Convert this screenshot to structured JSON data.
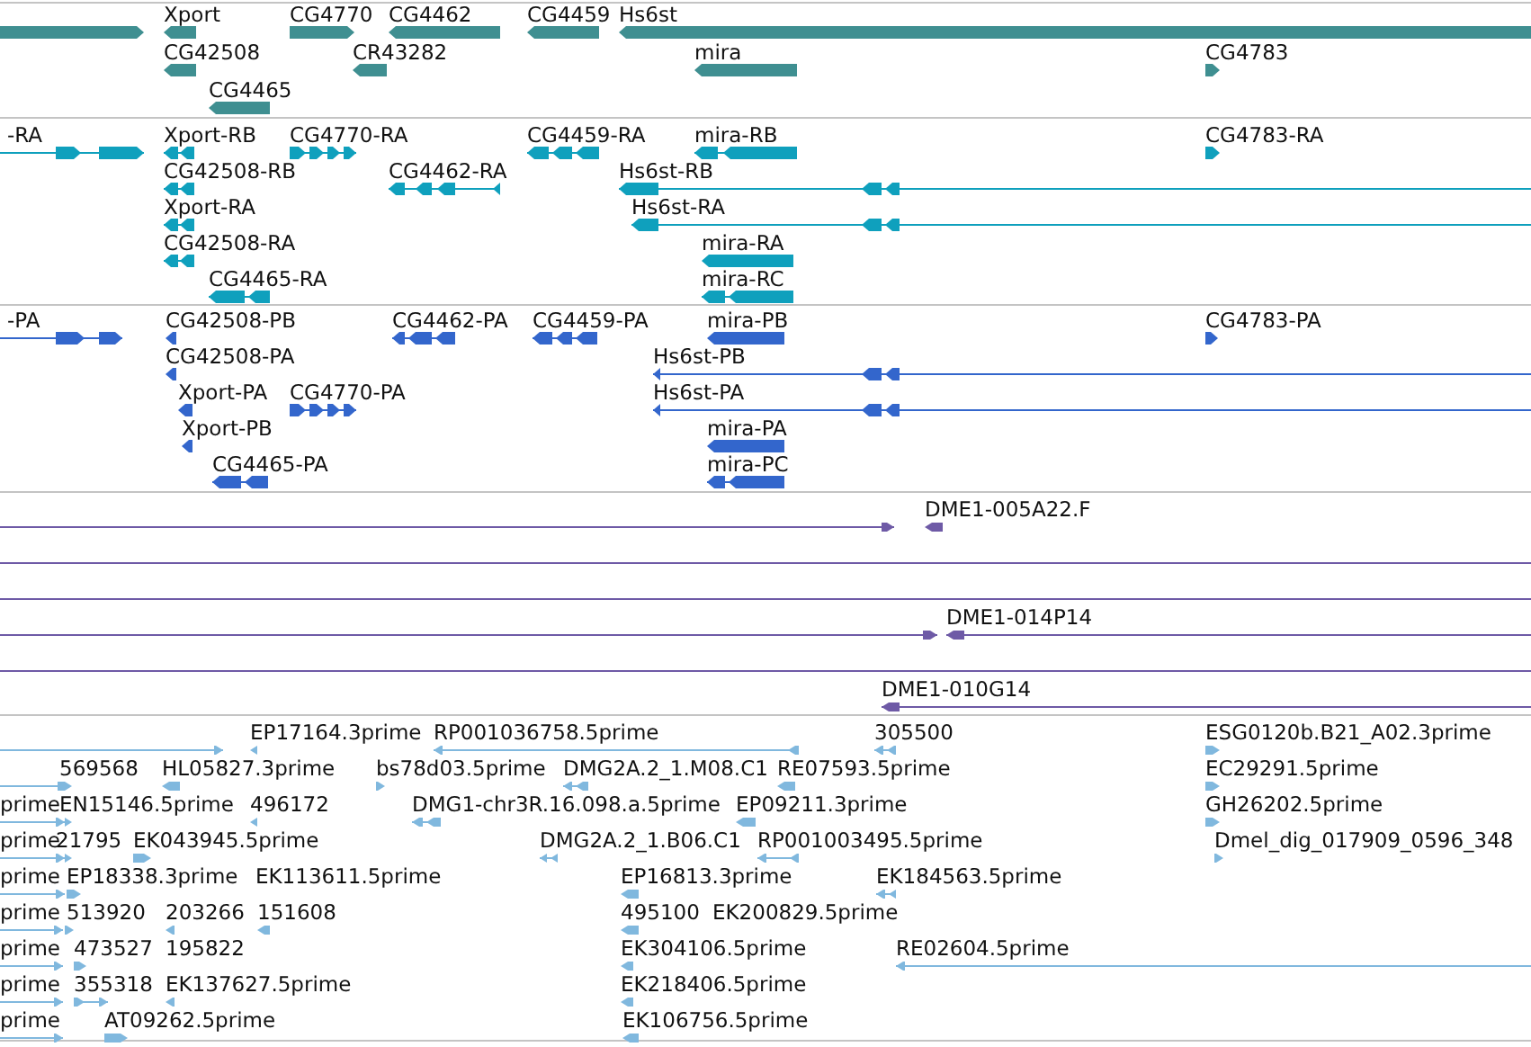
{
  "tracks": [
    {
      "color": "#3f8f91",
      "features": [
        {
          "kind": "bar",
          "reverse": false
        },
        {
          "kind": "bar",
          "label": "Xport",
          "reverse": true
        },
        {
          "kind": "bar",
          "label": "CG4770",
          "reverse": false
        },
        {
          "kind": "bar",
          "label": "CG4462",
          "reverse": true
        },
        {
          "kind": "bar",
          "label": "CG4459",
          "reverse": true
        },
        {
          "kind": "bar",
          "label": "Hs6st",
          "reverse": true
        },
        {
          "kind": "bar",
          "label": "CG42508",
          "reverse": true
        },
        {
          "kind": "bar",
          "label": "CR43282",
          "reverse": true
        },
        {
          "kind": "bar",
          "label": "mira",
          "reverse": true
        },
        {
          "kind": "bar",
          "label": "CG4783",
          "reverse": false
        },
        {
          "kind": "bar",
          "label": "CG4465",
          "reverse": true
        }
      ]
    },
    {
      "color": "#0fa0bd",
      "features": [
        {
          "kind": "exons",
          "label": "-RA",
          "reverse": false
        },
        {
          "kind": "exons",
          "label": "Xport-RB",
          "reverse": true
        },
        {
          "kind": "exons",
          "label": "CG4770-RA",
          "reverse": false
        },
        {
          "kind": "exons",
          "label": "CG4459-RA",
          "reverse": true
        },
        {
          "kind": "exons",
          "label": "mira-RB",
          "reverse": true
        },
        {
          "kind": "bar",
          "label": "CG4783-RA",
          "reverse": false
        },
        {
          "kind": "exons",
          "label": "CG42508-RB",
          "reverse": true
        },
        {
          "kind": "exons",
          "label": "CG4462-RA",
          "reverse": true
        },
        {
          "kind": "exons",
          "label": "Hs6st-RB",
          "reverse": true
        },
        {
          "kind": "exons",
          "label": "Xport-RA",
          "reverse": true
        },
        {
          "kind": "exons",
          "label": "Hs6st-RA",
          "reverse": true
        },
        {
          "kind": "exons",
          "label": "CG42508-RA",
          "reverse": true
        },
        {
          "kind": "bar",
          "label": "mira-RA",
          "reverse": true
        },
        {
          "kind": "exons",
          "label": "CG4465-RA",
          "reverse": true
        },
        {
          "kind": "exons",
          "label": "mira-RC",
          "reverse": true
        }
      ]
    },
    {
      "color": "#3366cc",
      "features": [
        {
          "kind": "exons",
          "label": "-PA",
          "reverse": false
        },
        {
          "kind": "bar",
          "label": "CG42508-PB",
          "reverse": true
        },
        {
          "kind": "exons",
          "label": "CG4462-PA",
          "reverse": true
        },
        {
          "kind": "exons",
          "label": "CG4459-PA",
          "reverse": true
        },
        {
          "kind": "bar",
          "label": "mira-PB",
          "reverse": true
        },
        {
          "kind": "bar",
          "label": "CG4783-PA",
          "reverse": false
        },
        {
          "kind": "bar",
          "label": "CG42508-PA",
          "reverse": true
        },
        {
          "kind": "exons",
          "label": "Hs6st-PB",
          "reverse": true
        },
        {
          "kind": "bar",
          "label": "Xport-PA",
          "reverse": true
        },
        {
          "kind": "exons",
          "label": "CG4770-PA",
          "reverse": false
        },
        {
          "kind": "exons",
          "label": "Hs6st-PA",
          "reverse": true
        },
        {
          "kind": "bar",
          "label": "Xport-PB",
          "reverse": true
        },
        {
          "kind": "bar",
          "label": "mira-PA",
          "reverse": true
        },
        {
          "kind": "exons",
          "label": "CG4465-PA",
          "reverse": true
        },
        {
          "kind": "exons",
          "label": "mira-PC",
          "reverse": true
        }
      ]
    },
    {
      "color": "#6e5aa6",
      "features": [
        {
          "kind": "exons",
          "reverse": false
        },
        {
          "kind": "bar",
          "label": "DME1-005A22.F",
          "reverse": true
        },
        {
          "kind": "line"
        },
        {
          "kind": "line"
        },
        {
          "kind": "exons",
          "reverse": false
        },
        {
          "kind": "exons",
          "label": "DME1-014P14",
          "reverse": true
        },
        {
          "kind": "line"
        },
        {
          "kind": "exons",
          "label": "DME1-010G14",
          "reverse": true
        }
      ]
    },
    {
      "color": "#80b8de",
      "features": [
        {
          "kind": "exons",
          "reverse": false
        },
        {
          "kind": "bar",
          "label": "EP17164.3prime",
          "reverse": true
        },
        {
          "kind": "exons",
          "label": "RP001036758.5prime",
          "reverse": true
        },
        {
          "kind": "exons",
          "label": "305500",
          "reverse": true
        },
        {
          "kind": "bar",
          "label": "ESG0120b.B21_A02.3prime",
          "reverse": false
        },
        {
          "kind": "line"
        },
        {
          "kind": "bar",
          "label": "569568",
          "reverse": false
        },
        {
          "kind": "bar",
          "label": "HL05827.3prime",
          "reverse": true
        },
        {
          "kind": "bar",
          "label": "bs78d03.5prime",
          "reverse": false
        },
        {
          "kind": "exons",
          "label": "DMG2A.2_1.M08.C1",
          "reverse": true
        },
        {
          "kind": "bar",
          "label": "RE07593.5prime",
          "reverse": true
        },
        {
          "kind": "bar",
          "label": "EC29291.5prime",
          "reverse": false
        },
        {
          "kind": "exons",
          "label": "prime",
          "reverse": false
        },
        {
          "kind": "bar",
          "label": "EN15146.5prime",
          "reverse": false
        },
        {
          "kind": "bar",
          "label": "496172",
          "reverse": true
        },
        {
          "kind": "exons",
          "label": "DMG1-chr3R.16.098.a.5prime",
          "reverse": true
        },
        {
          "kind": "bar",
          "label": "EP09211.3prime",
          "reverse": true
        },
        {
          "kind": "bar",
          "label": "GH26202.5prime",
          "reverse": false
        },
        {
          "kind": "exons",
          "label": "prime",
          "reverse": false
        },
        {
          "kind": "bar",
          "label": "21795",
          "reverse": false
        },
        {
          "kind": "bar",
          "label": "EK043945.5prime",
          "reverse": false
        },
        {
          "kind": "exons",
          "label": "DMG2A.2_1.B06.C1",
          "reverse": true
        },
        {
          "kind": "exons",
          "label": "RP001003495.5prime",
          "reverse": true
        },
        {
          "kind": "bar",
          "label": "Dmel_dig_017909_0596_348",
          "reverse": false
        },
        {
          "kind": "exons",
          "label": "prime",
          "reverse": false
        },
        {
          "kind": "bar",
          "label": "EP18338.3prime",
          "reverse": false
        },
        {
          "kind": "label",
          "label": "EK113611.5prime"
        },
        {
          "kind": "bar",
          "label": "EP16813.3prime",
          "reverse": true
        },
        {
          "kind": "exons",
          "label": "EK184563.5prime",
          "reverse": true
        },
        {
          "kind": "exons",
          "label": "prime",
          "reverse": false
        },
        {
          "kind": "bar",
          "label": "513920",
          "reverse": false
        },
        {
          "kind": "bar",
          "label": "203266",
          "reverse": true
        },
        {
          "kind": "bar",
          "label": "151608",
          "reverse": true
        },
        {
          "kind": "bar",
          "label": "495100",
          "reverse": true
        },
        {
          "kind": "label",
          "label": "EK200829.5prime"
        },
        {
          "kind": "exons",
          "label": "prime",
          "reverse": false
        },
        {
          "kind": "bar",
          "label": "473527",
          "reverse": false
        },
        {
          "kind": "label",
          "label": "195822"
        },
        {
          "kind": "bar",
          "label": "EK304106.5prime",
          "reverse": true
        },
        {
          "kind": "exons",
          "label": "RE02604.5prime",
          "reverse": true
        },
        {
          "kind": "exons",
          "label": "prime",
          "reverse": false
        },
        {
          "kind": "exons",
          "label": "355318",
          "reverse": false
        },
        {
          "kind": "bar",
          "label": "EK137627.5prime",
          "reverse": true
        },
        {
          "kind": "bar",
          "label": "EK218406.5prime",
          "reverse": true
        },
        {
          "kind": "exons",
          "label": "prime",
          "reverse": false
        },
        {
          "kind": "bar",
          "label": "AT09262.5prime",
          "reverse": false
        },
        {
          "kind": "bar",
          "label": "EK106756.5prime",
          "reverse": true
        }
      ]
    }
  ]
}
